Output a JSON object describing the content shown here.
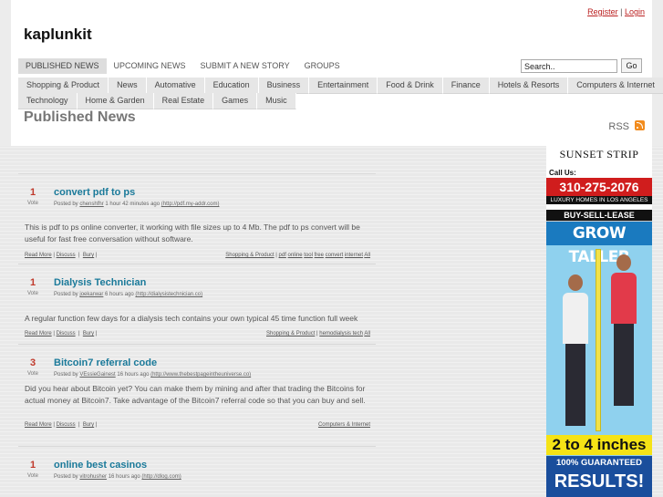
{
  "auth": {
    "register": "Register",
    "sep": "|",
    "login": "Login"
  },
  "site": {
    "logo": "kaplunkit"
  },
  "topnav": [
    {
      "label": "PUBLISHED NEWS",
      "active": true
    },
    {
      "label": "UPCOMING NEWS"
    },
    {
      "label": "SUBMIT A NEW STORY"
    },
    {
      "label": "GROUPS"
    }
  ],
  "search": {
    "value": "Search..",
    "go": "Go"
  },
  "categories_row1": [
    "Shopping & Product",
    "News",
    "Automative",
    "Education",
    "Business",
    "Entertainment",
    "Food & Drink",
    "Finance",
    "Hotels & Resorts",
    "Computers & Internet"
  ],
  "categories_row2": [
    "Technology",
    "Home & Garden",
    "Real Estate",
    "Games",
    "Music"
  ],
  "page": {
    "title": "Published News",
    "rss": "RSS"
  },
  "stories": [
    {
      "votes": "1",
      "vote_label": "Vote",
      "title": "convert pdf to ps",
      "posted_by": "Posted by",
      "author": "chenshfhr",
      "time": "1 hour 42 minutes ago",
      "url": "(http://pdf.my-addr.com)",
      "body": "This is pdf to ps online converter, it working with file sizes up to 4 Mb. The pdf to ps convert will be useful for fast free conversation without software.",
      "read_more": "Read More",
      "discuss": "Discuss",
      "bury": "Bury",
      "tags": [
        "Shopping & Product",
        "pdf",
        "online",
        "tool",
        "free",
        "convert",
        "internet",
        "All"
      ]
    },
    {
      "votes": "1",
      "vote_label": "Vote",
      "title": "Dialysis Technician",
      "posted_by": "Posted by",
      "author": "joekarwar",
      "time": "6 hours ago",
      "url": "(http://dialysistechnician.co)",
      "body": "A regular function few days for a dialysis tech contains your own typical 45 time function full week",
      "read_more": "Read More",
      "discuss": "Discuss",
      "bury": "Bury",
      "tags": [
        "Shopping & Product",
        "hemodialysis tech",
        "All"
      ]
    },
    {
      "votes": "3",
      "vote_label": "Vote",
      "title": "Bitcoin7 referral code",
      "posted_by": "Posted by",
      "author": "VEssieGainest",
      "time": "16 hours ago",
      "url": "(http://www.thebestpageintheuniverse.co)",
      "body": "Did you hear about Bitcoin yet? You can make them by mining and after that trading the Bitcoins for actual money at Bitcoin7. Take advantage of the Bitcoin7 referral code so that you can buy and sell.",
      "read_more": "Read More",
      "discuss": "Discuss",
      "bury": "Bury",
      "tags": [
        "Computers & Internet"
      ]
    },
    {
      "votes": "1",
      "vote_label": "Vote",
      "title": "online best casinos",
      "posted_by": "Posted by",
      "author": "vitrohusher",
      "time": "16 hours ago",
      "url": "(http://dlog.com)"
    }
  ],
  "ad_sunset": {
    "brand": "SUNSET STRIP",
    "call_us": "Call Us:",
    "phone": "310-275-2076",
    "luxury": "LUXURY HOMES IN LOS ANGELES",
    "buy_sell": "BUY-SELL-LEASE"
  },
  "ad_grow": {
    "headline": "GROW TALLER",
    "inches": "2 to 4 inches",
    "guaranteed": "100% GUARANTEED",
    "results": "RESULTS!"
  },
  "colors": {
    "accent_link": "#1b7a9a",
    "vote_red": "#c0392b",
    "rss_orange": "#f28c1e"
  }
}
